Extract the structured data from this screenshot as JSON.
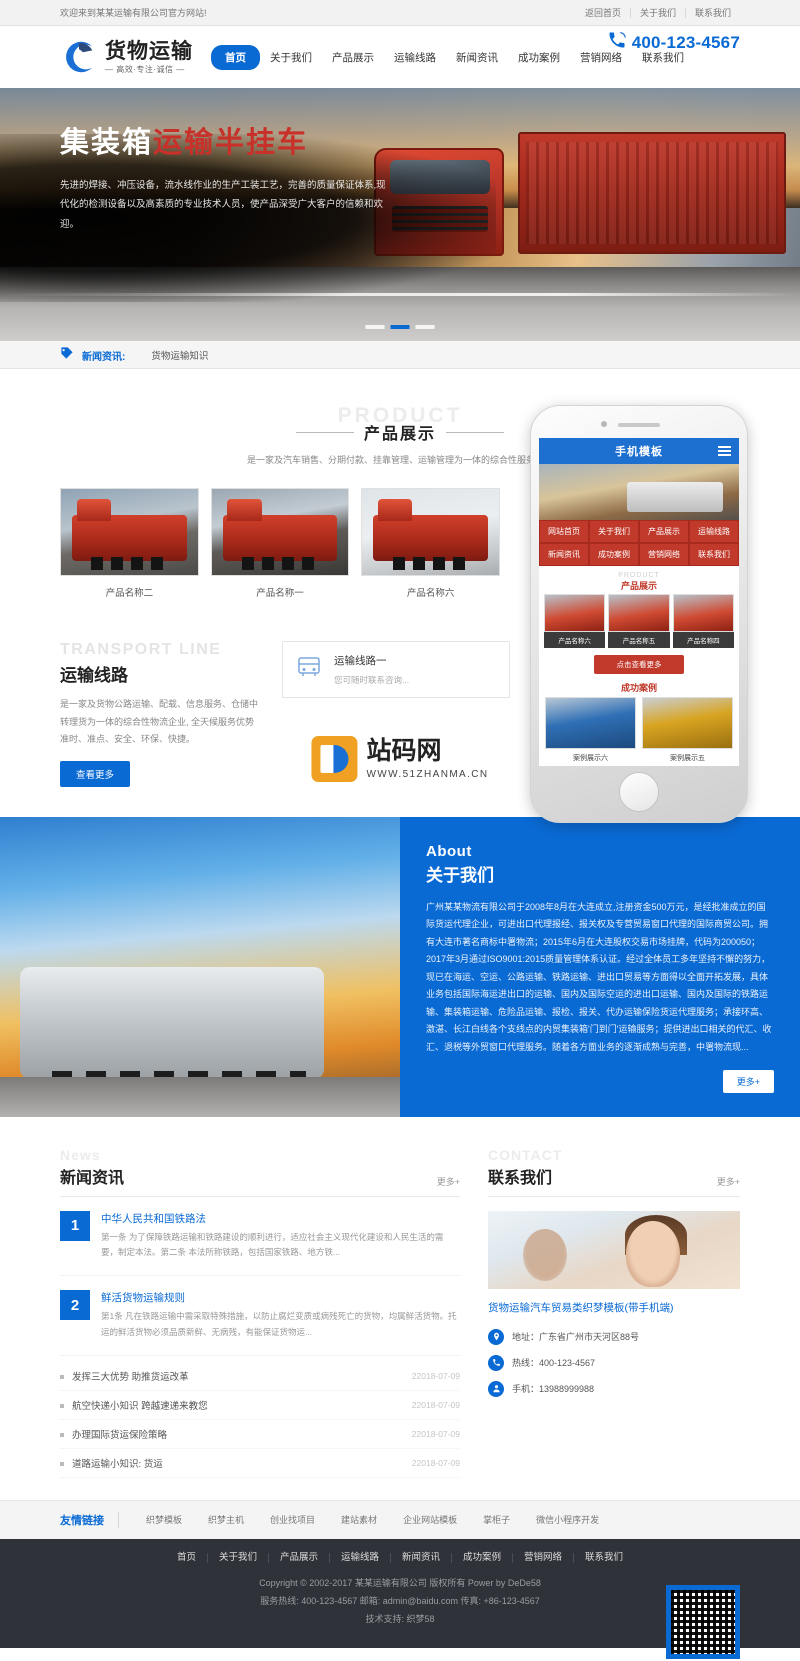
{
  "topbar": {
    "welcome": "欢迎来到某某运输有限公司官方网站!",
    "links": [
      "返回首页",
      "关于我们",
      "联系我们"
    ]
  },
  "header": {
    "logo_title": "货物运输",
    "logo_sub": "— 高效·专注·诚信 —",
    "nav": [
      {
        "label": "首页",
        "active": true
      },
      {
        "label": "关于我们",
        "active": false
      },
      {
        "label": "产品展示",
        "active": false
      },
      {
        "label": "运输线路",
        "active": false
      },
      {
        "label": "新闻资讯",
        "active": false
      },
      {
        "label": "成功案例",
        "active": false
      },
      {
        "label": "营销网络",
        "active": false
      },
      {
        "label": "联系我们",
        "active": false
      }
    ],
    "phone": "400-123-4567"
  },
  "hero": {
    "title_white": "集装箱",
    "title_red": "运输半挂车",
    "desc": "先进的焊接、冲压设备，流水线作业的生产工装工艺，完善的质量保证体系,现代化的检测设备以及高素质的专业技术人员，使产品深受广大客户的信赖和欢迎。",
    "dots": 3,
    "active_dot": 1
  },
  "ticker": {
    "label": "新闻资讯:",
    "item": "货物运输知识"
  },
  "product": {
    "en": "PRODUCT",
    "cn": "产品展示",
    "sub": "是一家及汽车销售、分期付款、挂靠管理、运输管理为一体的综合性服务公司",
    "items": [
      {
        "name": "产品名称二"
      },
      {
        "name": "产品名称一"
      },
      {
        "name": "产品名称六"
      }
    ]
  },
  "transport": {
    "en": "TRANSPORT LINE",
    "cn": "运输线路",
    "desc": "是一家及货物公路运输、配载、信息服务、仓储中转理货为一体的综合性物流企业, 全天候服务优势准时、准点、安全、环保、快捷。",
    "button": "查看更多",
    "route": {
      "title": "运输线路一",
      "sub": "您可随时联系咨询..."
    }
  },
  "phone_mock": {
    "title": "手机模板",
    "nav": [
      "网站首页",
      "关于我们",
      "产品展示",
      "运输线路",
      "新闻资讯",
      "成功案例",
      "营销网络",
      "联系我们"
    ],
    "section_en": "PRODUCT",
    "section_cn": "产品展示",
    "products": [
      "产品名称六",
      "产品名称五",
      "产品名称四"
    ],
    "more": "点击查看更多",
    "section2_cn": "成功案例",
    "cases": [
      "案例展示六",
      "案例展示五"
    ]
  },
  "watermark": {
    "name": "站码网",
    "url": "WWW.51ZHANMA.CN"
  },
  "about": {
    "en": "About",
    "cn": "关于我们",
    "body": "广州某某物流有限公司于2008年8月在大连成立,注册资金500万元，是经批准成立的国际货运代理企业，可进出口代理报经、报关权及专营贸易窗口代理的国际商贸公司。拥有大连市著名商标中署物流；2015年6月在大连股权交易市场挂牌，代码为200050；2017年3月通过ISO9001:2015质量管理体系认证。经过全体员工多年坚持不懈的努力，现已在海运、空运、公路运输、铁路运输、进出口贸易等方面得以全面开拓发展，具体业务包括国际海运进出口的运输、国内及国际空运的进出口运输、国内及国际的铁路运输、集装箱运输、危险品运输、报检、报关、代办运输保险货运代理服务；承接环高、激湛、长江白线各个支线点的内贸集装箱'门到门'运输服务；提供进出口相关的代汇、收汇、退税等外贸窗口代理服务。随着各方面业务的逐渐成熟与完善，中署物流现...",
    "more": "更多+"
  },
  "news": {
    "en": "News",
    "cn": "新闻资讯",
    "more": "更多+",
    "featured": [
      {
        "num": "1",
        "title": "中华人民共和国铁路法",
        "summary": "第一条 为了保障铁路运输和铁路建设的顺利进行，适应社会主义现代化建设和人民生活的需要，制定本法。第二条 本法所称铁路，包括国家铁路、地方铁..."
      },
      {
        "num": "2",
        "title": "鲜活货物运输规则",
        "summary": "第1条 凡在铁路运输中需采取特殊措施，以防止腐烂变质或病残死亡的货物，均属鲜活货物。托运的鲜活货物必须品质新鲜、无病残，有能保证货物运..."
      }
    ],
    "list": [
      {
        "title": "发挥三大优势 助推货运改革",
        "date": "22018-07-09"
      },
      {
        "title": "航空快递小知识 跨越速递来教您",
        "date": "22018-07-09"
      },
      {
        "title": "办理国际货运保险策略",
        "date": "22018-07-09"
      },
      {
        "title": "道路运输小知识: 货运",
        "date": "22018-07-09"
      }
    ]
  },
  "contact": {
    "en": "CONTACT",
    "cn": "联系我们",
    "more": "更多+",
    "company": "货物运输汽车贸易类织梦模板(带手机端)",
    "rows": [
      {
        "icon": "location-icon",
        "glyph": "◉",
        "text": "地址：广东省广州市天河区88号"
      },
      {
        "icon": "hotline-icon",
        "glyph": "☎",
        "text": "热线：400-123-4567"
      },
      {
        "icon": "mobile-icon",
        "glyph": "♟",
        "text": "手机：13988999988"
      }
    ]
  },
  "friends": {
    "label": "友情链接",
    "links": [
      "织梦模板",
      "织梦主机",
      "创业找项目",
      "建站素材",
      "企业网站模板",
      "掌柜子",
      "微信小程序开发"
    ]
  },
  "footer": {
    "nav": [
      "首页",
      "关于我们",
      "产品展示",
      "运输线路",
      "新闻资讯",
      "成功案例",
      "营销网络",
      "联系我们"
    ],
    "copyright": "Copyright © 2002-2017 某某运输有限公司 版权所有 Power by DeDe58",
    "service": "服务热线: 400-123-4567 邮箱: admin@baidu.com 传真: +86-123-4567",
    "support": "技术支持: 织梦58"
  },
  "colors": {
    "brand_blue": "#0a6ad4",
    "accent_red": "#c0392b",
    "dark_footer": "#2f3238"
  }
}
